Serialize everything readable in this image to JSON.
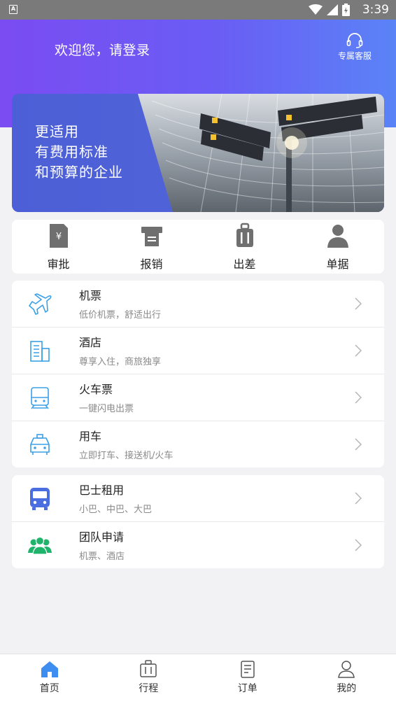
{
  "status_bar": {
    "time": "3:39",
    "app_icon_letter": "A"
  },
  "header": {
    "welcome": "欢迎您，请登录",
    "service_label": "专属客服"
  },
  "banner": {
    "line1": "更适用",
    "line2": "有费用标准",
    "line3": "和预算的企业"
  },
  "quick_actions": [
    {
      "label": "审批",
      "icon": "approval-icon"
    },
    {
      "label": "报销",
      "icon": "reimburse-icon"
    },
    {
      "label": "出差",
      "icon": "luggage-icon"
    },
    {
      "label": "单据",
      "icon": "person-icon"
    }
  ],
  "services": [
    {
      "title": "机票",
      "subtitle": "低价机票，舒适出行",
      "icon": "plane-icon"
    },
    {
      "title": "酒店",
      "subtitle": "尊享入住，商旅独享",
      "icon": "hotel-icon"
    },
    {
      "title": "火车票",
      "subtitle": "一键闪电出票",
      "icon": "train-icon"
    },
    {
      "title": "用车",
      "subtitle": "立即打车、接送机/火车",
      "icon": "car-icon"
    }
  ],
  "extra_services": [
    {
      "title": "巴士租用",
      "subtitle": "小巴、中巴、大巴",
      "icon": "bus-icon"
    },
    {
      "title": "团队申请",
      "subtitle": "机票、酒店",
      "icon": "team-icon"
    }
  ],
  "tabs": [
    {
      "label": "首页",
      "icon": "home-icon",
      "active": true
    },
    {
      "label": "行程",
      "icon": "suitcase-icon",
      "active": false
    },
    {
      "label": "订单",
      "icon": "order-icon",
      "active": false
    },
    {
      "label": "我的",
      "icon": "profile-icon",
      "active": false
    }
  ],
  "colors": {
    "accent": "#6a5df4",
    "icon_gray": "#6f6f6f",
    "service_blue": "#3aa0e8",
    "bus_blue": "#4a6ee0",
    "team_green": "#1fb36b",
    "tab_active": "#3d8ef0"
  }
}
